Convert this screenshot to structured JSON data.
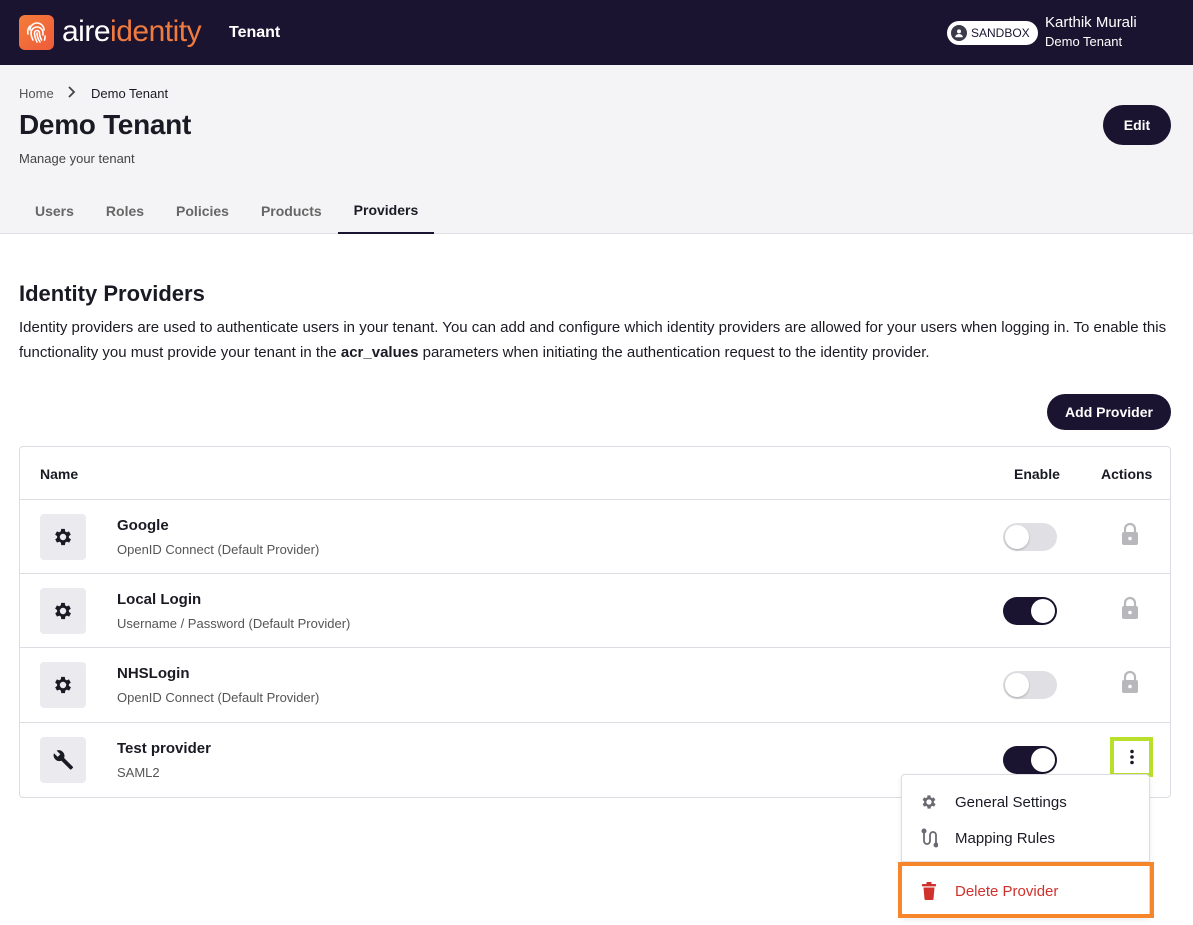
{
  "topbar": {
    "logo_aire": "aire",
    "logo_identity": "identity",
    "title": "Tenant",
    "sandbox_label": "SANDBOX",
    "user_name": "Karthik Murali",
    "user_tenant": "Demo Tenant"
  },
  "breadcrumb": {
    "home": "Home",
    "current": "Demo Tenant"
  },
  "page": {
    "title": "Demo Tenant",
    "subtitle": "Manage your tenant",
    "edit_label": "Edit"
  },
  "tabs": [
    {
      "label": "Users"
    },
    {
      "label": "Roles"
    },
    {
      "label": "Policies"
    },
    {
      "label": "Products"
    },
    {
      "label": "Providers",
      "active": true
    }
  ],
  "section": {
    "title": "Identity Providers",
    "desc_part1": "Identity providers are used to authenticate users in your tenant. You can add and configure which identity providers are allowed for your users when logging in. To enable this functionality you must provide your tenant in the ",
    "desc_bold": "acr_values",
    "desc_part2": " parameters when initiating the authentication request to the identity provider.",
    "add_label": "Add Provider"
  },
  "table": {
    "headers": {
      "name": "Name",
      "enable": "Enable",
      "actions": "Actions"
    },
    "rows": [
      {
        "name": "Google",
        "type": "OpenID Connect (Default Provider)",
        "enabled": false,
        "icon": "gear-icon",
        "action": "lock-icon"
      },
      {
        "name": "Local Login",
        "type": "Username / Password (Default Provider)",
        "enabled": true,
        "icon": "gear-icon",
        "action": "lock-icon"
      },
      {
        "name": "NHSLogin",
        "type": "OpenID Connect (Default Provider)",
        "enabled": false,
        "icon": "gear-icon",
        "action": "lock-icon"
      },
      {
        "name": "Test provider",
        "type": "SAML2",
        "enabled": true,
        "icon": "wrench-icon",
        "action": "kebab-icon"
      }
    ]
  },
  "menu": {
    "items": [
      {
        "label": "General Settings",
        "icon": "gear-icon"
      },
      {
        "label": "Mapping Rules",
        "icon": "route-icon"
      },
      {
        "label": "Delete Provider",
        "icon": "trash-icon"
      }
    ]
  },
  "colors": {
    "brand_dark": "#1b1430",
    "brand_orange": "#f07b3f",
    "danger": "#d0312d",
    "highlight_green": "#b8e02a",
    "highlight_orange": "#f7852a"
  }
}
